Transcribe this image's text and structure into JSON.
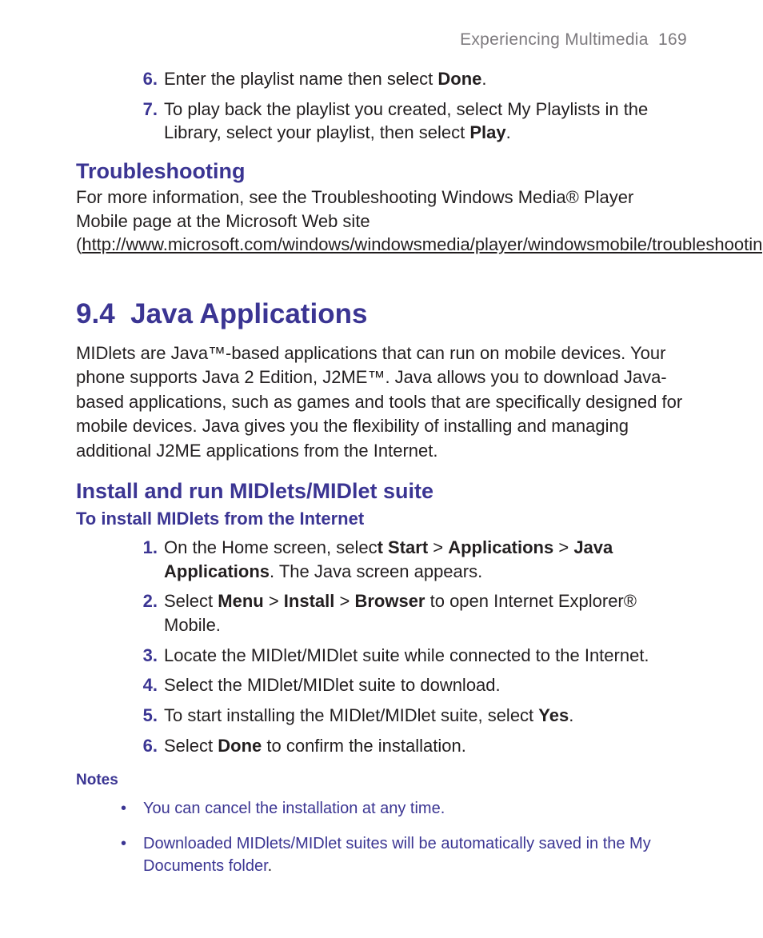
{
  "running_head": {
    "chapter": "Experiencing Multimedia",
    "page": "169"
  },
  "continued_steps": [
    {
      "n": "6.",
      "pre": "Enter the playlist name then select ",
      "b1": "Done",
      "post": "."
    },
    {
      "n": "7.",
      "pre": "To play back the playlist you created, select My Playlists in the Library, select your playlist, then select ",
      "b1": "Play",
      "post": "."
    }
  ],
  "troubleshooting": {
    "heading": "Troubleshooting",
    "para_pre": "For more information, see the Troubleshooting Windows Media® Player Mobile page at the Microsoft Web site (",
    "link": "http://www.microsoft.com/windows/windowsmedia/player/windowsmobile/troubleshooting.aspx",
    "para_post": ")."
  },
  "section": {
    "number": "9.4",
    "title": "Java Applications",
    "intro": "MIDlets are Java™-based applications that can run on mobile devices. Your phone supports Java 2 Edition, J2ME™. Java allows you to download Java-based applications, such as games and tools that are specifically designed for mobile devices. Java gives you the flexibility of installing and managing additional J2ME applications from the Internet."
  },
  "install": {
    "heading": "Install and run MIDlets/MIDlet suite",
    "subheading": "To install MIDlets from the Internet",
    "steps": {
      "s1": {
        "n": "1.",
        "a": "On the Home screen, selec",
        "b1": "t Start",
        "gt1": " > ",
        "b2": "Applications",
        "gt2": " > ",
        "b3": "Java Applications",
        "tail": ". The Java screen appears."
      },
      "s2": {
        "n": "2.",
        "a": "Select ",
        "b1": "Menu",
        "gt1": " > ",
        "b2": "Install",
        "gt2": " > ",
        "b3": "Browser",
        "tail": " to open Internet Explorer® Mobile."
      },
      "s3": {
        "n": "3.",
        "text": "Locate the MIDlet/MIDlet suite while connected to the Internet."
      },
      "s4": {
        "n": "4.",
        "text": "Select the MIDlet/MIDlet suite to download."
      },
      "s5": {
        "n": "5.",
        "a": "To start installing the MIDlet/MIDlet suite, select ",
        "b1": "Yes",
        "tail": "."
      },
      "s6": {
        "n": "6.",
        "a": "Select ",
        "b1": "Done",
        "tail": " to confirm the installation."
      }
    }
  },
  "notes": {
    "label": "Notes",
    "items": [
      "You can cancel the installation at any time.",
      "Downloaded MIDlets/MIDlet suites will be automatically saved in the My Documents folder"
    ],
    "period": "."
  }
}
